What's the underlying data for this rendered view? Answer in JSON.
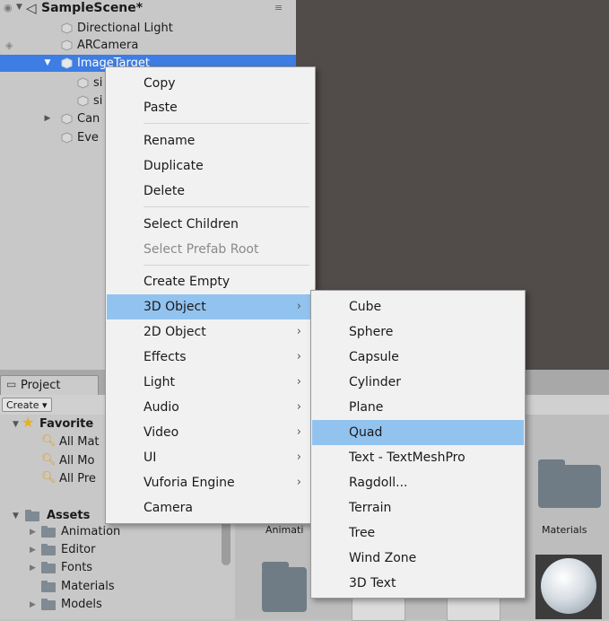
{
  "hierarchy": {
    "scene_name": "SampleScene*",
    "menu_icon": "≡",
    "rows": [
      {
        "label": "Directional Light"
      },
      {
        "label": "ARCamera"
      },
      {
        "label": "ImageTarget"
      },
      {
        "label": "si"
      },
      {
        "label": "si"
      },
      {
        "label": "Can"
      },
      {
        "label": "Eve"
      }
    ]
  },
  "project": {
    "tab_label": "Project",
    "create_label": "Create ▾",
    "favorites_label": "Favorite",
    "favorites": [
      "All Mat",
      "All Mo",
      "All Pre"
    ],
    "assets_label": "Assets",
    "asset_folders": [
      "Animation",
      "Editor",
      "Fonts",
      "Materials",
      "Models"
    ],
    "grid_labels": {
      "animation": "Animati",
      "materials": "Materials"
    }
  },
  "context_menu": {
    "items": [
      {
        "label": "Copy"
      },
      {
        "label": "Paste"
      },
      {
        "label": "Rename"
      },
      {
        "label": "Duplicate"
      },
      {
        "label": "Delete"
      },
      {
        "label": "Select Children"
      },
      {
        "label": "Select Prefab Root",
        "disabled": true
      },
      {
        "label": "Create Empty"
      },
      {
        "label": "3D Object",
        "submenu": true,
        "highlighted": true
      },
      {
        "label": "2D Object",
        "submenu": true
      },
      {
        "label": "Effects",
        "submenu": true
      },
      {
        "label": "Light",
        "submenu": true
      },
      {
        "label": "Audio",
        "submenu": true
      },
      {
        "label": "Video",
        "submenu": true
      },
      {
        "label": "UI",
        "submenu": true
      },
      {
        "label": "Vuforia Engine",
        "submenu": true
      },
      {
        "label": "Camera"
      }
    ],
    "arrow_glyph": "›"
  },
  "submenu_3d": {
    "items": [
      {
        "label": "Cube"
      },
      {
        "label": "Sphere"
      },
      {
        "label": "Capsule"
      },
      {
        "label": "Cylinder"
      },
      {
        "label": "Plane"
      },
      {
        "label": "Quad",
        "highlighted": true
      },
      {
        "label": "Text - TextMeshPro"
      },
      {
        "label": "Ragdoll..."
      },
      {
        "label": "Terrain"
      },
      {
        "label": "Tree"
      },
      {
        "label": "Wind Zone"
      },
      {
        "label": "3D Text"
      }
    ]
  },
  "colors": {
    "highlight": "#92c3ef",
    "selection_row": "#3e7de3",
    "scene_view": "#514b49"
  }
}
